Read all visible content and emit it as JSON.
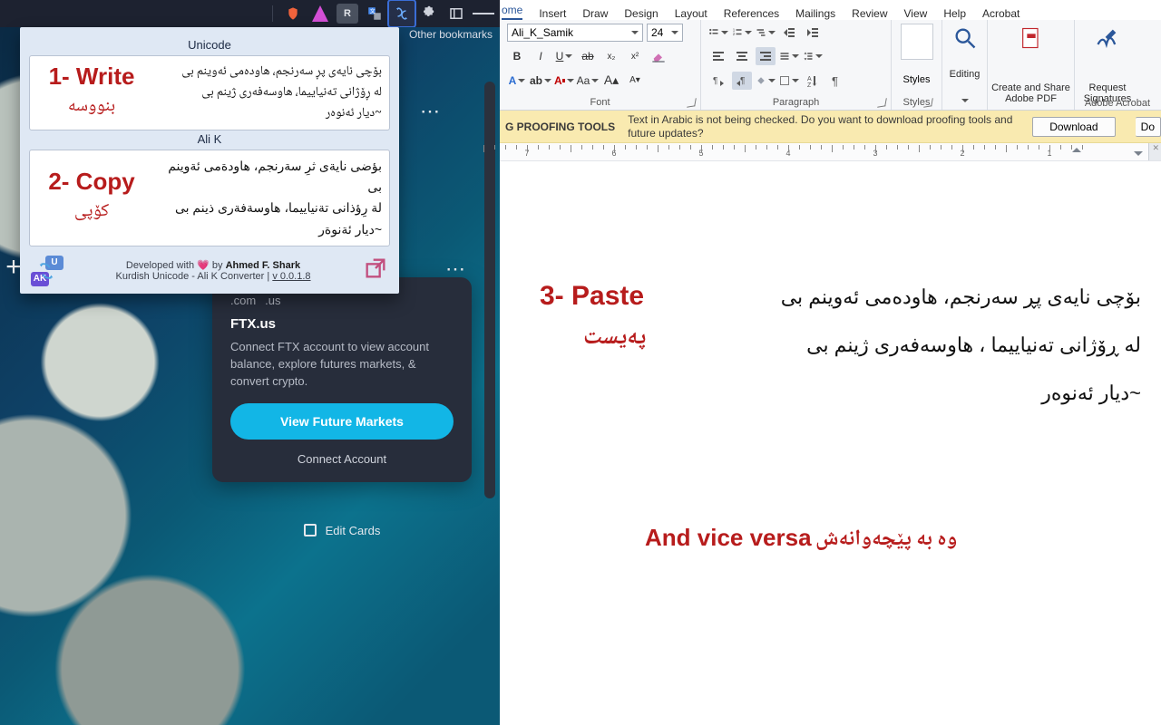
{
  "browser": {
    "toolbar": {
      "other_bookmarks": "Other bookmarks"
    },
    "ntp": {
      "addsite": "+",
      "dots": "⋯",
      "ftx": {
        "pill_com": ".com",
        "pill_us": ".us",
        "title": "FTX.us",
        "desc": "Connect FTX account to view account balance, explore futures markets, & convert crypto.",
        "cta": "View Future Markets",
        "connect": "Connect Account"
      },
      "edit_cards": "Edit Cards"
    }
  },
  "ext": {
    "label_unicode": "Unicode",
    "label_alik": "Ali K",
    "step1_en": "1- Write",
    "step1_ku": "بنووسە",
    "step2_en": "2- Copy",
    "step2_ku": "کۆپی",
    "text_unicode": "بۆچی نایەی پڕ سەرنجم، هاودەمی ئەوینم بی\nلە ڕۆژانی تەنیاییما، هاوسەفەری ژینم بی\n~دیار ئەنوەر",
    "text_alik": "بؤضى نايةى ثرِ سةرنجم، هاودةمى ئةوينم بى\nلة رِؤذانى تةنياييما، هاوسةفةرى ذينم بى\n~ديار ئةنوةر",
    "credit_pre": "Developed with ",
    "credit_by": " by ",
    "credit_name": "Ahmed F. Shark",
    "credit_line2": "Kurdish Unicode - Ali K Converter | ",
    "version": "v 0.0.1.8",
    "heart": "💗"
  },
  "word": {
    "tabs": [
      "ome",
      "Insert",
      "Draw",
      "Design",
      "Layout",
      "References",
      "Mailings",
      "Review",
      "View",
      "Help",
      "Acrobat"
    ],
    "active_tab_index": 0,
    "font_name": "Ali_K_Samik",
    "font_size": "24",
    "groups": {
      "font": "Font",
      "paragraph": "Paragraph",
      "styles": "Styles",
      "acrobat": "Adobe Acrobat"
    },
    "cmds": {
      "styles": "Styles",
      "editing": "Editing",
      "create_pdf": "Create and Share Adobe PDF",
      "req_sig": "Request Signatures"
    },
    "yellow": {
      "left": "G PROOFING TOOLS",
      "msg": "Text in Arabic is not being checked. Do you want to download proofing tools and future updates?",
      "download": "Download",
      "do": "Do"
    },
    "ruler_nums": [
      "7",
      "6",
      "5",
      "4",
      "3",
      "2",
      "1"
    ],
    "doc": {
      "step3_en": "3- Paste",
      "step3_ku": "پەیست",
      "poem_l1": "بۆچی نایەی پڕ سەرنجم، هاودەمی ئەوینم بی",
      "poem_l2": "لە ڕۆژانی تەنیاییما ، هاوسەفەری ژینم بی",
      "poem_l3": "~دیار ئەنوەر",
      "vice_en": "And vice versa",
      "vice_ku": "وە بە پێچەوانەش"
    }
  }
}
